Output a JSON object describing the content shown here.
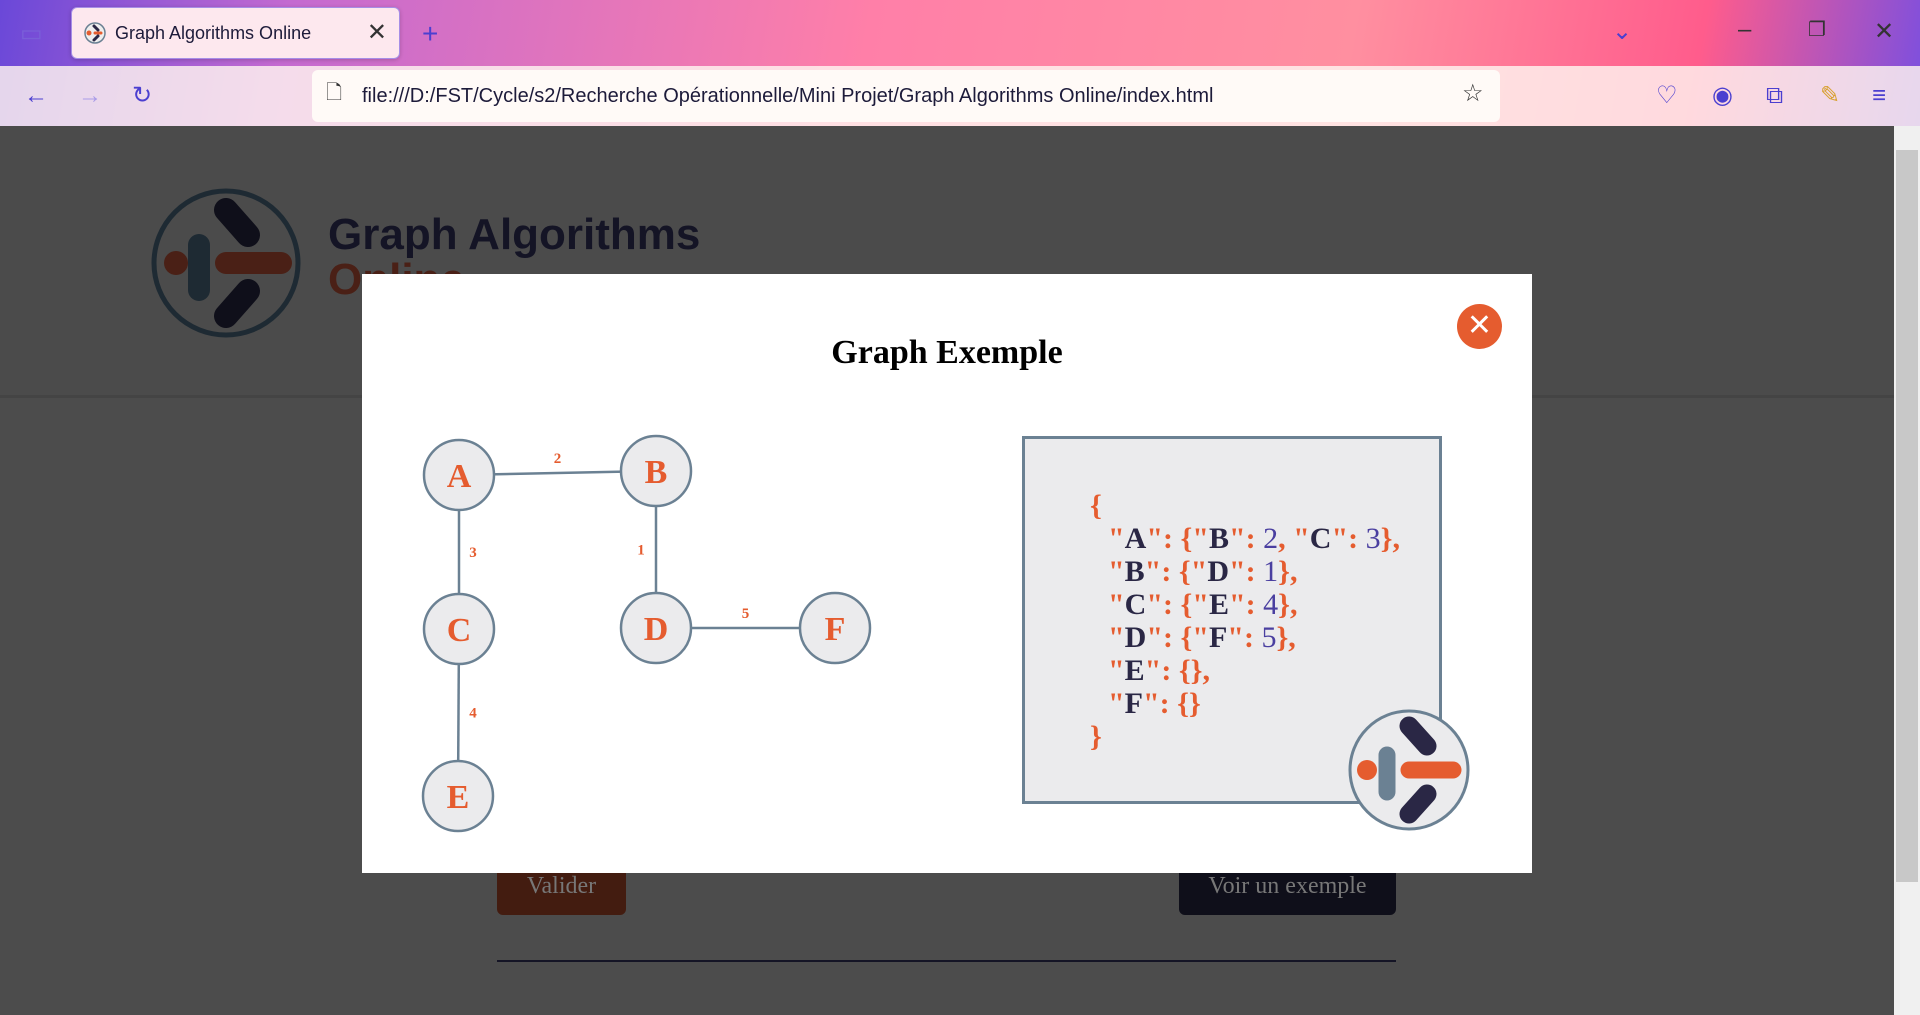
{
  "browser": {
    "tab_title": "Graph Algorithms Online",
    "url": "file:///D:/FST/Cycle/s2/Recherche Opérationnelle/Mini Projet/Graph Algorithms Online/index.html"
  },
  "site": {
    "title": "Graph Algorithms",
    "subtitle": "Online"
  },
  "buttons": {
    "validate": "Valider",
    "example": "Voir un exemple"
  },
  "modal": {
    "title": "Graph Exemple",
    "close_icon": "x-icon",
    "graph": {
      "nodes": [
        "A",
        "B",
        "C",
        "D",
        "E",
        "F"
      ],
      "edges": [
        {
          "from": "A",
          "to": "B",
          "weight": "2"
        },
        {
          "from": "A",
          "to": "C",
          "weight": "3"
        },
        {
          "from": "B",
          "to": "D",
          "weight": "1"
        },
        {
          "from": "C",
          "to": "E",
          "weight": "4"
        },
        {
          "from": "D",
          "to": "F",
          "weight": "5"
        }
      ]
    },
    "json_lines": [
      [
        "{"
      ],
      [
        "\"A\": {\"B\": 2, \"C\": 3},"
      ],
      [
        "\"B\": {\"D\": 1},"
      ],
      [
        "\"C\": {\"E\": 4},"
      ],
      [
        "\"D\": {\"F\": 5},"
      ],
      [
        "\"E\": {},"
      ],
      [
        "\"F\": {}"
      ],
      [
        "}"
      ]
    ]
  },
  "colors": {
    "accent": "#e55c2f",
    "dark": "#2a2745",
    "node_border": "#6b8193",
    "overlay": "#4c4c4c"
  }
}
